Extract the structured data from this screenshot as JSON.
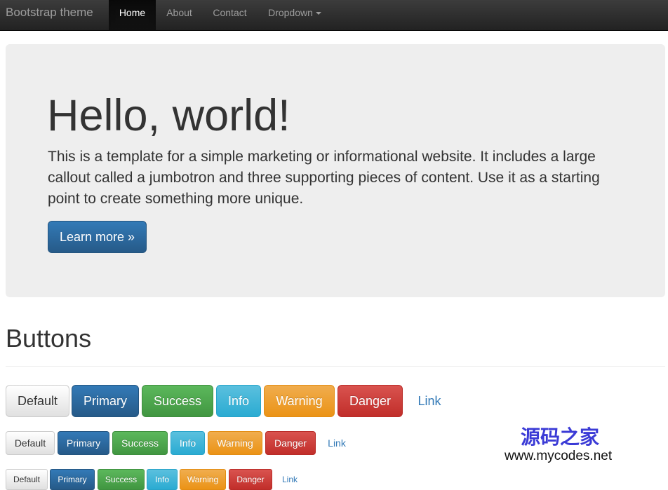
{
  "navbar": {
    "brand": "Bootstrap theme",
    "items": [
      {
        "label": "Home",
        "active": true
      },
      {
        "label": "About"
      },
      {
        "label": "Contact"
      },
      {
        "label": "Dropdown"
      }
    ],
    "dropdown_icon": "caret-down-icon"
  },
  "jumbotron": {
    "title": "Hello, world!",
    "text": "This is a template for a simple marketing or informational website. It includes a large callout called a jumbotron and three supporting pieces of content. Use it as a starting point to create something more unique.",
    "button": "Learn more »"
  },
  "buttons_section": {
    "title": "Buttons",
    "rows": [
      {
        "size": "large",
        "labels": [
          "Default",
          "Primary",
          "Success",
          "Info",
          "Warning",
          "Danger",
          "Link"
        ]
      },
      {
        "size": "default",
        "labels": [
          "Default",
          "Primary",
          "Success",
          "Info",
          "Warning",
          "Danger",
          "Link"
        ]
      },
      {
        "size": "small",
        "labels": [
          "Default",
          "Primary",
          "Success",
          "Info",
          "Warning",
          "Danger",
          "Link"
        ]
      }
    ]
  },
  "colors": {
    "primary": "#337ab7",
    "success": "#5cb85c",
    "info": "#5bc0de",
    "warning": "#f0ad4e",
    "danger": "#d9534f",
    "navbar": "#222222",
    "jumbotron": "#eeeeee"
  },
  "watermark": {
    "logo_text": "源码之家",
    "url": "www.mycodes.net"
  }
}
